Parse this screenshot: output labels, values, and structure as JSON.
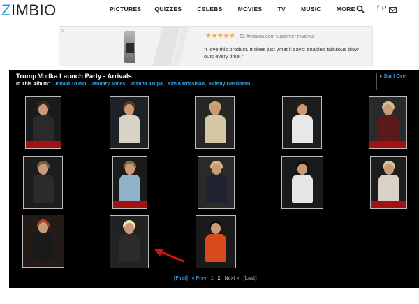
{
  "brand": {
    "logo_first": "Z",
    "logo_rest": "IMBIO",
    "accent": "#2a9fd6"
  },
  "nav": [
    {
      "label": "PICTURES"
    },
    {
      "label": "QUIZZES"
    },
    {
      "label": "CELEBS"
    },
    {
      "label": "MOVIES"
    },
    {
      "label": "TV"
    },
    {
      "label": "MUSIC"
    },
    {
      "label": "MORE"
    }
  ],
  "header_icons": [
    "search-icon",
    "facebook-icon",
    "pinterest-icon",
    "mail-icon"
  ],
  "social": {
    "facebook": "f",
    "pinterest": "P"
  },
  "ad": {
    "choice": "▷",
    "stars": "★★★★★",
    "reviews": "63 Amazon.com customer reviews",
    "quote": "\"I love this product. It does just what it says: enables fabulous blow outs every time. \""
  },
  "album": {
    "title": "Trump Vodka Launch Party - Arrivals",
    "in_album_label": "In This Album:",
    "people": [
      "Donald Trump,",
      "January Jones,",
      "Joanna Krupa,",
      "Kim Kardashian,",
      "Brittny Gastineau"
    ],
    "start_over": "Start Over"
  },
  "thumbnails": [
    {
      "bg": "#1b1b1b",
      "hair": "#3b2a1e",
      "body": "#2a2a2a",
      "carpet": true
    },
    {
      "bg": "#1e2226",
      "hair": "#5a3b24",
      "body": "#d8d2c8",
      "carpet": false
    },
    {
      "bg": "#262626",
      "hair": "#c9a86a",
      "body": "#d7c6a6",
      "carpet": false
    },
    {
      "bg": "#1c1c1c",
      "hair": "#2a1f18",
      "body": "#e8e8e8",
      "carpet": false
    },
    {
      "bg": "#2a2a2a",
      "hair": "#d6c08a",
      "body": "#5a1a1a",
      "carpet": true
    },
    {
      "bg": "#1d1d1d",
      "hair": "#7a5a3a",
      "body": "#2b2b2b",
      "carpet": false
    },
    {
      "bg": "#1b1b1b",
      "hair": "#8a6a40",
      "body": "#8fb1c9",
      "carpet": true
    },
    {
      "bg": "#2a2a2a",
      "hair": "#d8b87a",
      "body": "#1f2230",
      "carpet": false
    },
    {
      "bg": "#1a1a1a",
      "hair": "#111111",
      "body": "#e6e6e6",
      "carpet": false
    },
    {
      "bg": "#1d1d1d",
      "hair": "#d5c29a",
      "body": "#d8d2c6",
      "carpet": true
    },
    {
      "bg": "#241a18",
      "hair": "#a7401e",
      "body": "#1a1a1a",
      "carpet": false
    },
    {
      "bg": "#222222",
      "hair": "#ede2b2",
      "body": "#2b2b2b",
      "carpet": false
    },
    {
      "bg": "#1a1a1a",
      "hair": "#111111",
      "body": "#d64a1c",
      "carpet": false
    }
  ],
  "pager": {
    "first": "[First]",
    "prev": "« Prev",
    "page1": "1",
    "page2": "2",
    "next": "Next »",
    "last": "[Last]"
  },
  "arrow_color": "#d01414"
}
